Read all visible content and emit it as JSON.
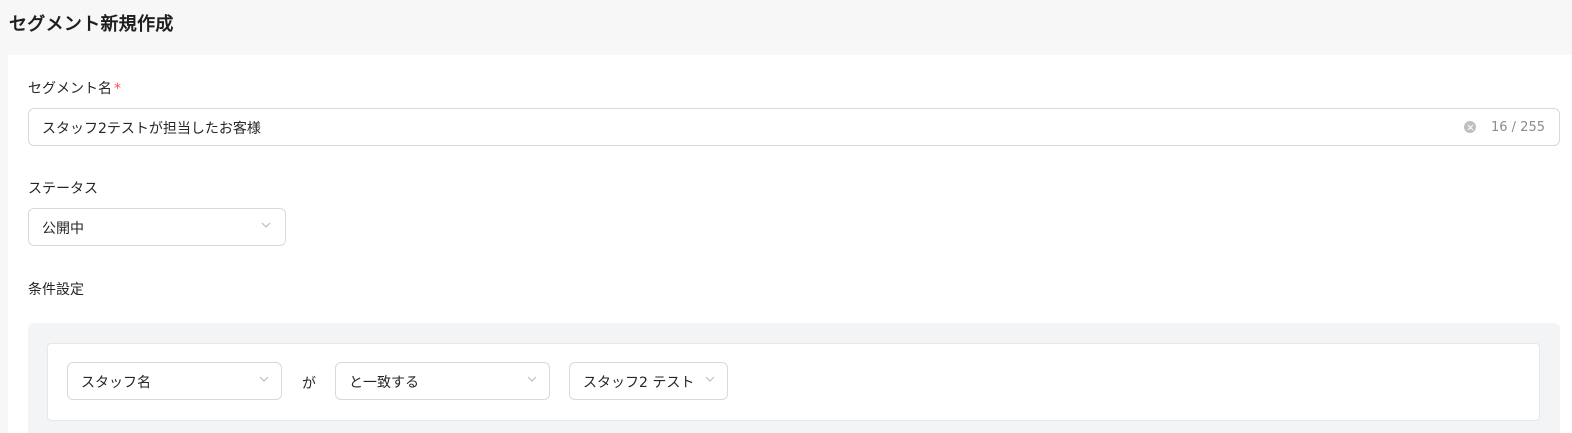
{
  "header": {
    "title": "セグメント新規作成"
  },
  "form": {
    "segment_name": {
      "label": "セグメント名",
      "required_mark": "*",
      "value": "スタッフ2テストが担当したお客様",
      "char_count": "16 / 255"
    },
    "status": {
      "label": "ステータス",
      "selected": "公開中"
    },
    "conditions": {
      "label": "条件設定",
      "row": {
        "field": "スタッフ名",
        "connector": "が",
        "operator": "と一致する",
        "value": "スタッフ2 テスト"
      }
    }
  },
  "colors": {
    "required": "#ff4d4f",
    "border": "#d9d9d9",
    "panel_bg": "#f3f4f6"
  }
}
